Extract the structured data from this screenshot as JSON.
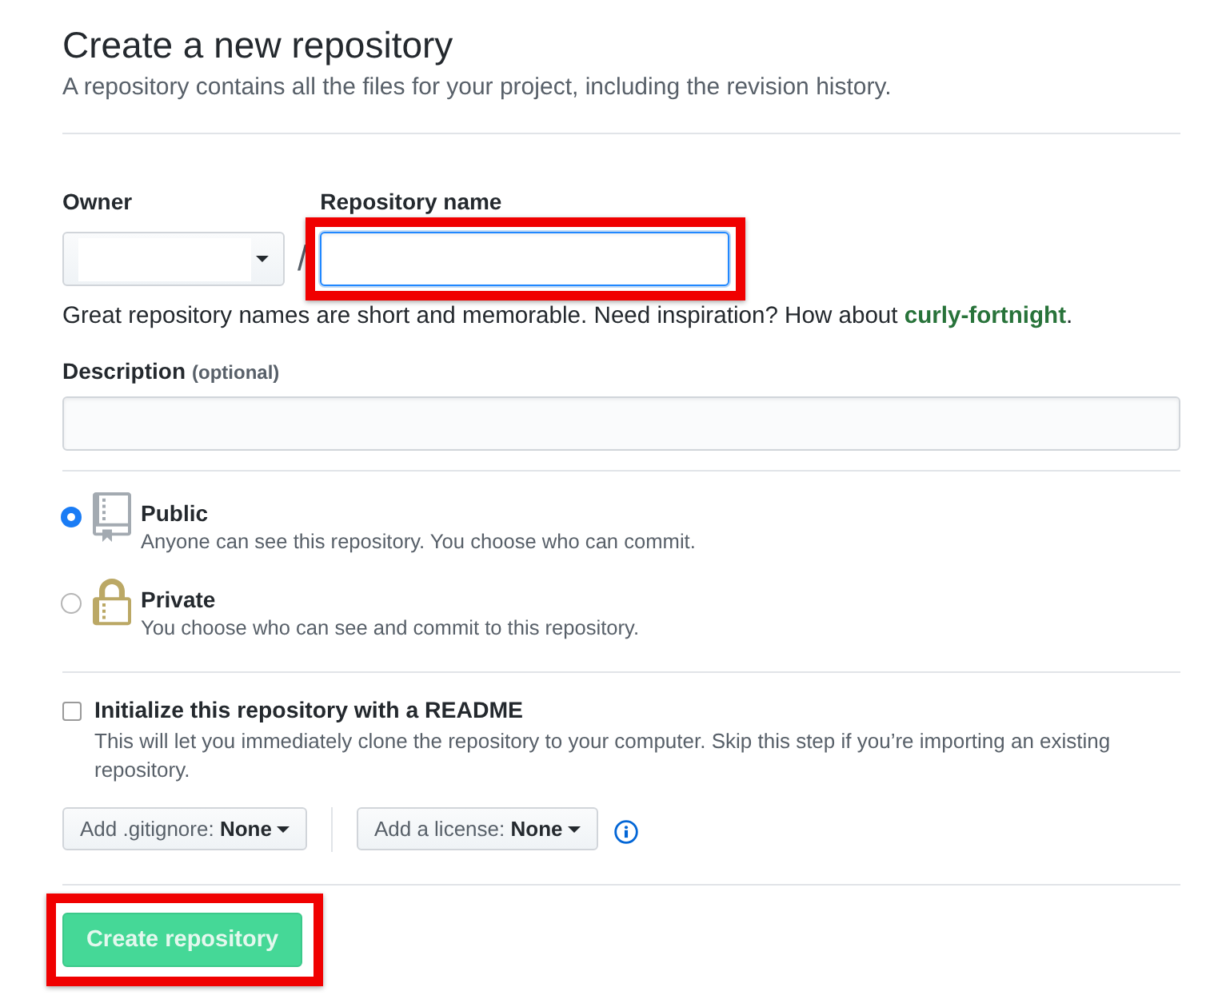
{
  "header": {
    "title": "Create a new repository",
    "subtitle": "A repository contains all the files for your project, including the revision history."
  },
  "owner": {
    "label": "Owner"
  },
  "separator": "/",
  "repository_name": {
    "label": "Repository name",
    "focused": true,
    "highlighted": true
  },
  "name_hint": {
    "text": "Great repository names are short and memorable. Need inspiration? How about ",
    "suggestion": "curly-fortnight",
    "suffix": "."
  },
  "description": {
    "label": "Description",
    "note": "(optional)"
  },
  "visibility": [
    {
      "kind": "public",
      "title": "Public",
      "text": "Anyone can see this repository. You choose who can commit.",
      "selected": true
    },
    {
      "kind": "private",
      "title": "Private",
      "text": "You choose who can see and commit to this repository.",
      "selected": false
    }
  ],
  "readme": {
    "label": "Initialize this repository with a README",
    "text": "This will let you immediately clone the repository to your computer. Skip this step if you’re importing an existing repository.",
    "checked": false
  },
  "gitignore_dropdown": {
    "label": "Add .gitignore: **None**"
  },
  "license_dropdown": {
    "label": "Add a license: **None**"
  },
  "submit": {
    "label": "Create repository",
    "disabled": true,
    "highlighted": true
  }
}
